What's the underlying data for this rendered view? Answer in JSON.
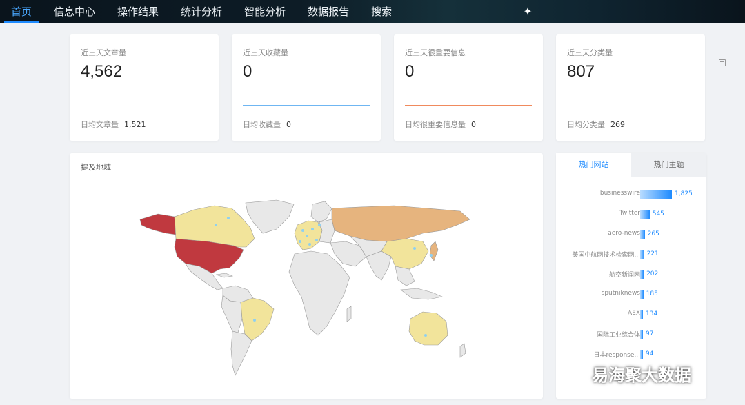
{
  "nav": {
    "items": [
      "首页",
      "信息中心",
      "操作结果",
      "统计分析",
      "智能分析",
      "数据报告",
      "搜索"
    ],
    "active_index": 0,
    "star_icon": "sparkle-icon"
  },
  "stats": [
    {
      "title": "近三天文章量",
      "value": "4,562",
      "foot_label": "日均文章量",
      "foot_value": "1,521",
      "line_color": ""
    },
    {
      "title": "近三天收藏量",
      "value": "0",
      "foot_label": "日均收藏量",
      "foot_value": "0",
      "line_color": "#6fb6f2"
    },
    {
      "title": "近三天很重要信息",
      "value": "0",
      "foot_label": "日均很重要信息量",
      "foot_value": "0",
      "line_color": "#f08a5d"
    },
    {
      "title": "近三天分类量",
      "value": "807",
      "foot_label": "日均分类量",
      "foot_value": "269",
      "line_color": ""
    }
  ],
  "map_panel": {
    "title": "提及地域",
    "colors": {
      "high": "#c0393f",
      "mid": "#e6b47e",
      "low": "#f2e49b",
      "none": "#e8e8e8",
      "point": "#8fd0f0"
    }
  },
  "hot_panel": {
    "tabs": [
      "热门网站",
      "热门主题"
    ],
    "active_tab": 0,
    "items": [
      {
        "label": "businesswire",
        "value": 1825
      },
      {
        "label": "Twitter",
        "value": 545
      },
      {
        "label": "aero-news",
        "value": 265
      },
      {
        "label": "美国中航网技术检索网...",
        "value": 221
      },
      {
        "label": "航空新闻网",
        "value": 202
      },
      {
        "label": "sputniknews",
        "value": 185
      },
      {
        "label": "AEX",
        "value": 134
      },
      {
        "label": "国际工业综合体",
        "value": 97
      },
      {
        "label": "日本response...",
        "value": 94
      }
    ],
    "max_value": 1825
  },
  "watermark": {
    "text": "易海聚大数据",
    "icon": "wechat-icon"
  }
}
